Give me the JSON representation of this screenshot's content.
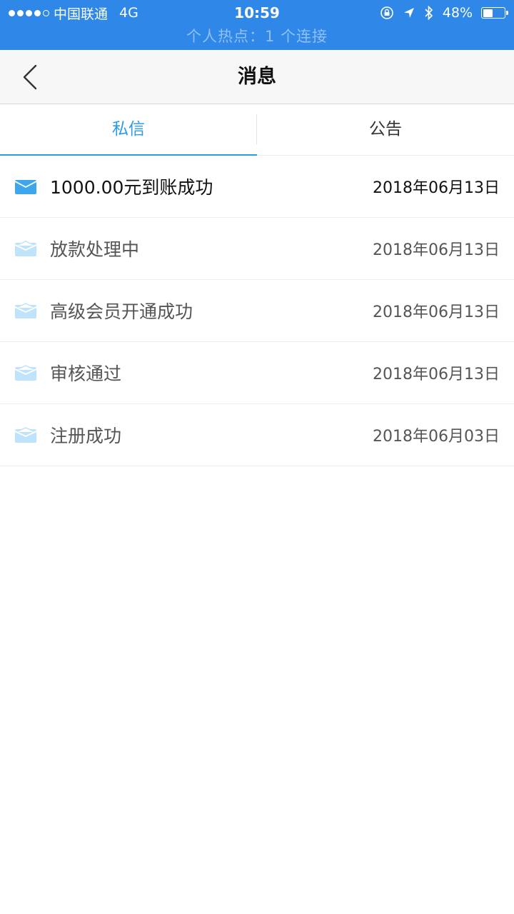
{
  "status_bar": {
    "carrier": "中国联通",
    "network": "4G",
    "time": "10:59",
    "battery": "48%",
    "battery_level": 0.48,
    "hotspot": "个人热点：1 个连接",
    "bg_color": "#2f87e8"
  },
  "nav": {
    "title": "消息",
    "back_icon": "chevron-left-icon"
  },
  "tabs": [
    {
      "label": "私信",
      "active": true
    },
    {
      "label": "公告",
      "active": false
    }
  ],
  "accent_color": "#2b9be6",
  "messages": [
    {
      "title": "1000.00元到账成功",
      "date": "2018年06月13日",
      "unread": true
    },
    {
      "title": "放款处理中",
      "date": "2018年06月13日",
      "unread": false
    },
    {
      "title": "高级会员开通成功",
      "date": "2018年06月13日",
      "unread": false
    },
    {
      "title": "审核通过",
      "date": "2018年06月13日",
      "unread": false
    },
    {
      "title": "注册成功",
      "date": "2018年06月03日",
      "unread": false
    }
  ]
}
